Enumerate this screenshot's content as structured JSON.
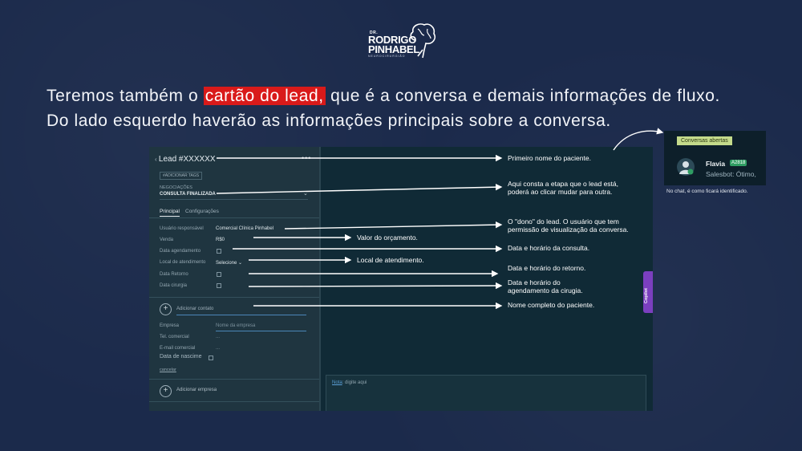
{
  "logo": {
    "line1": "DR.",
    "line2a": "RODRIGO",
    "line2b": "PINHABEL",
    "line3": "NEUROCIRURGIÃO"
  },
  "headline": {
    "line1_before": "Teremos também o ",
    "line1_highlight": "cartão do lead,",
    "line1_after": " que é a conversa e demais informações de fluxo.",
    "line2": "Do lado esquerdo haverão as informações principais sobre a conversa."
  },
  "lead_card": {
    "title": "Lead #XXXXXX",
    "more_icon": "ellipsis-icon",
    "add_tags": "#ADICIONAR TAGS",
    "negotiations_label": "NEGOCIAÇÕES",
    "negotiations_value": "CONSULTA FINALIZADA",
    "tabs": [
      "Principal",
      "Configurações"
    ],
    "fields": [
      {
        "label": "Usuário responsável",
        "value": "Comercial Clínica Pinhabel"
      },
      {
        "label": "Venda",
        "value": "R$0"
      },
      {
        "label": "Data agendamento",
        "value": ""
      },
      {
        "label": "Local de atendimento",
        "value": "Selecione"
      },
      {
        "label": "Data Retorno",
        "value": ""
      },
      {
        "label": "Data cirurgia",
        "value": ""
      }
    ],
    "add_contact": "Adicionar contato",
    "company_label": "Empresa",
    "company_placeholder": "Nome da empresa",
    "tel_label": "Tel. comercial",
    "tel_value": "...",
    "email_label": "E-mail comercial",
    "email_value": "...",
    "birth_label": "Data de nascime",
    "cancel": "cancelar",
    "add_company": "Adicionar empresa",
    "note_link": "Nota",
    "note_placeholder": ": digite aqui",
    "copilot": "Copilot"
  },
  "annotations": {
    "a1": "Primeiro nome do paciente.",
    "a2_l1": "Aqui consta a etapa que o lead está,",
    "a2_l2": "poderá ao clicar mudar para outra.",
    "a3_l1": "O \"dono\" do lead. O usuário que tem",
    "a3_l2": "permissão de visualização da conversa.",
    "a4": "Valor do orçamento.",
    "a5": "Data e horário da consulta.",
    "a6": "Local de atendimento.",
    "a7": "Data e horário do retorno.",
    "a8_l1": "Data e horário do",
    "a8_l2": "agendamento da cirugia.",
    "a9": "Nome completo do paciente."
  },
  "chat_preview": {
    "badge": "Conversas abertas",
    "name": "Flavia",
    "id": "A2818",
    "message": "Salesbot: Ótimo,",
    "caption": "No chat, é como ficará identificado."
  },
  "colors": {
    "background": "#1b2a4b",
    "highlight": "#d91a1a",
    "copilot": "#7b3fbf",
    "badge": "#c4db8b"
  }
}
